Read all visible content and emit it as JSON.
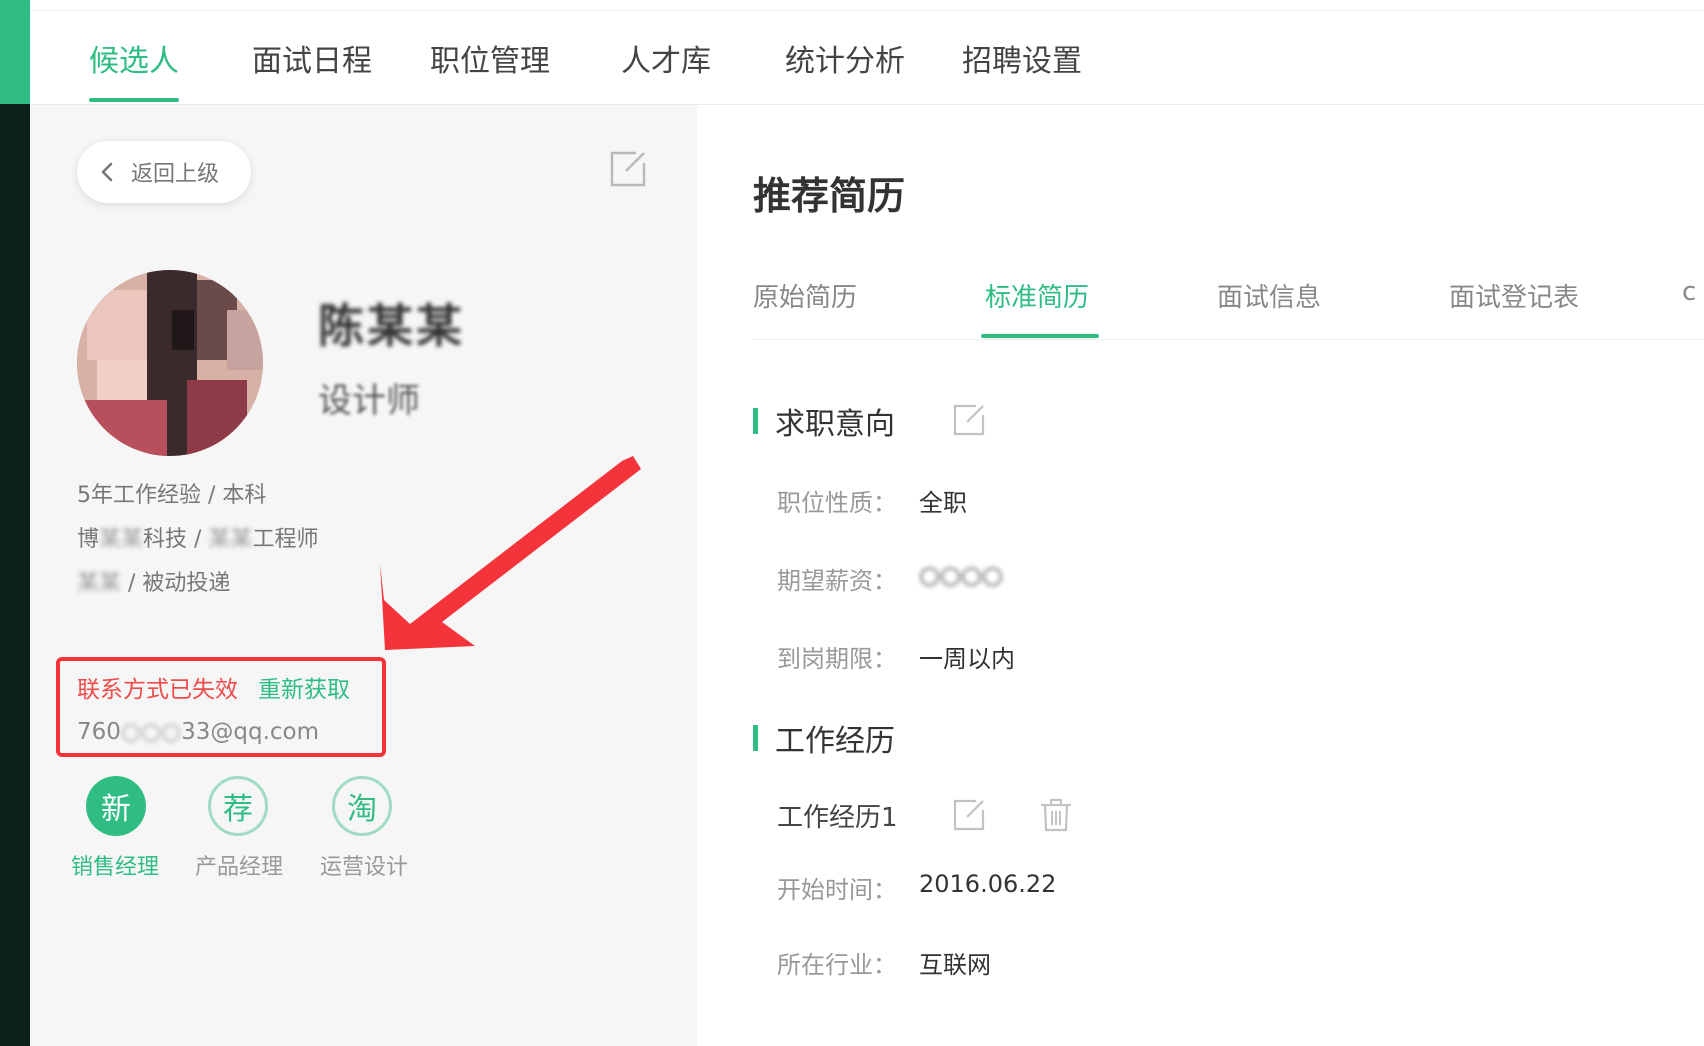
{
  "nav": {
    "items": [
      "候选人",
      "面试日程",
      "职位管理",
      "人才库",
      "统计分析",
      "招聘设置"
    ],
    "active": "候选人"
  },
  "sidebar": {
    "back_label": "返回上级",
    "candidate": {
      "name": "陈某某",
      "title": "设计师"
    },
    "experience_line": "5年工作经验 / 本科",
    "company_prefix": "博",
    "company_suffix": "科技 /",
    "company_blur": "某某",
    "job_blur": "某某",
    "job_suffix": "工程师",
    "source_blur": "某某",
    "source_suffix": "/ 被动投递",
    "contact_status": "联系方式已失效",
    "refetch_label": "重新获取",
    "email_prefix": "760",
    "email_blur": "○○○",
    "email_suffix": "33@qq.com",
    "positions": [
      {
        "icon": "新",
        "label": "销售经理"
      },
      {
        "icon": "荐",
        "label": "产品经理"
      },
      {
        "icon": "淘",
        "label": "运营设计"
      }
    ]
  },
  "main": {
    "title": "推荐简历",
    "tabs": [
      "原始简历",
      "标准简历",
      "面试信息",
      "面试登记表"
    ],
    "active_tab": "标准简历",
    "tab_overflow": "c",
    "intention": {
      "section_title": "求职意向",
      "fields": [
        {
          "label": "职位性质：",
          "value": "全职"
        },
        {
          "label": "期望薪资：",
          "value": "○○○○"
        },
        {
          "label": "到岗期限：",
          "value": "一周以内"
        }
      ]
    },
    "work": {
      "section_title": "工作经历",
      "entry_title": "工作经历1",
      "fields": [
        {
          "label": "开始时间：",
          "value": "2016.06.22"
        },
        {
          "label": "所在行业：",
          "value": "互联网"
        }
      ]
    }
  },
  "colors": {
    "accent": "#2fbd84",
    "alert": "#f4333a",
    "sidebar_bg": "#f6f6f6",
    "strip": "#0d211a"
  }
}
